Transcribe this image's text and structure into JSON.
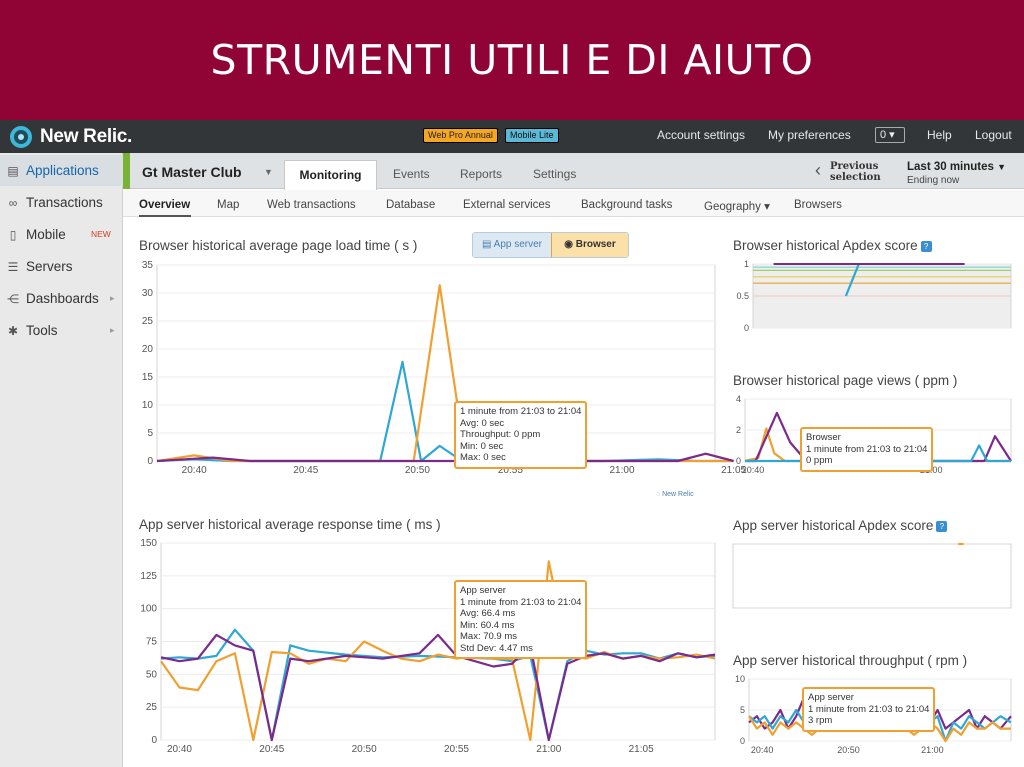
{
  "banner": {
    "title": "STRUMENTI UTILI E DI AIUTO"
  },
  "topbar": {
    "logo": "New Relic.",
    "badges": [
      "Web Pro Annual",
      "Mobile Lite"
    ],
    "links": [
      "Account settings",
      "My preferences",
      "Help",
      "Logout"
    ],
    "counter": "0 ▾"
  },
  "sidebar": {
    "items": [
      {
        "label": "Applications",
        "icon": "applications-icon",
        "active": true
      },
      {
        "label": "Transactions",
        "icon": "transactions-icon"
      },
      {
        "label": "Mobile",
        "icon": "mobile-icon",
        "badge": "NEW"
      },
      {
        "label": "Servers",
        "icon": "servers-icon"
      },
      {
        "label": "Dashboards",
        "icon": "dashboards-icon",
        "arrow": true
      },
      {
        "label": "Tools",
        "icon": "tools-icon",
        "arrow": true
      }
    ]
  },
  "appbar": {
    "app_name": "Gt Master Club",
    "tabs": [
      "Monitoring",
      "Events",
      "Reports",
      "Settings"
    ],
    "active_tab": "Monitoring",
    "previous_selection": [
      "Previous",
      "selection"
    ],
    "range": "Last 30 minutes",
    "range_sub": "Ending now"
  },
  "subnav": {
    "items": [
      "Overview",
      "Map",
      "Web transactions",
      "Database",
      "External services",
      "Background tasks",
      "Geography ▾",
      "Browsers"
    ],
    "active": "Overview"
  },
  "toggle": {
    "app_server": "App server",
    "browser": "Browser"
  },
  "watermark": "New Relic",
  "colors": {
    "banner": "#8f0335",
    "blue": "#2fa7d6",
    "orange": "#f0a030",
    "purple": "#7b2a8c"
  },
  "chart_data": [
    {
      "id": "browser-load",
      "type": "line",
      "title": "Browser historical average page load time ( s )",
      "ylim": [
        0,
        35
      ],
      "yticks": [
        0,
        5,
        10,
        15,
        20,
        25,
        30,
        35
      ],
      "xlim": [
        0,
        30
      ],
      "xticks": [
        {
          "x": 2,
          "label": "20:40"
        },
        {
          "x": 8,
          "label": "20:45"
        },
        {
          "x": 14,
          "label": "20:50"
        },
        {
          "x": 19,
          "label": "20:55"
        },
        {
          "x": 25,
          "label": "21:00"
        },
        {
          "x": 31,
          "label": "21:05"
        }
      ],
      "series": [
        {
          "color": "#2fa7d6",
          "x": [
            0,
            2,
            4,
            8,
            11,
            12,
            13.2,
            14.2,
            15.2,
            16.4,
            18,
            20,
            22,
            24,
            27,
            29,
            31
          ],
          "y": [
            0,
            0.3,
            0,
            0,
            0,
            0,
            17.7,
            0,
            2.7,
            0,
            0,
            0,
            0,
            0,
            0.3,
            0,
            0
          ]
        },
        {
          "color": "#f0a030",
          "x": [
            0,
            2,
            4,
            8,
            12,
            13.8,
            15.2,
            16.6,
            18,
            20,
            24,
            27,
            29,
            31
          ],
          "y": [
            0,
            1,
            0,
            0,
            0,
            0,
            31.4,
            0,
            0,
            0,
            0,
            0,
            0,
            0
          ]
        },
        {
          "color": "#7b2a8c",
          "x": [
            0,
            1.5,
            3,
            5,
            8,
            12,
            16,
            17.5,
            19,
            20.5,
            22,
            26,
            28,
            29.5,
            31
          ],
          "y": [
            0,
            0.3,
            0.6,
            0,
            0,
            0,
            0,
            1.3,
            1.4,
            0.3,
            0,
            0,
            0,
            1.3,
            0
          ]
        }
      ],
      "tooltip": [
        "1 minute from 21:03 to 21:04",
        "Avg: 0 sec",
        "Throughput: 0 ppm",
        "Min: 0 sec",
        "Max: 0 sec"
      ]
    },
    {
      "id": "app-response",
      "type": "line",
      "title": "App server historical average response time ( ms )",
      "ylim": [
        0,
        150
      ],
      "yticks": [
        0,
        25,
        50,
        75,
        100,
        125,
        150
      ],
      "xlim": [
        0,
        30
      ],
      "xticks": [
        {
          "x": 1,
          "label": "20:40"
        },
        {
          "x": 6,
          "label": "20:45"
        },
        {
          "x": 11,
          "label": "20:50"
        },
        {
          "x": 16,
          "label": "20:55"
        },
        {
          "x": 21,
          "label": "21:00"
        },
        {
          "x": 26,
          "label": "21:05"
        }
      ],
      "series": [
        {
          "color": "#2fa7d6",
          "x": [
            0,
            1,
            2,
            3,
            4,
            5,
            6,
            7,
            8,
            10,
            12,
            14,
            16,
            18,
            19,
            20,
            21,
            22,
            23,
            24,
            25,
            26,
            27,
            28,
            29,
            30
          ],
          "y": [
            62,
            63,
            62,
            64,
            84,
            68,
            0,
            72,
            68,
            65,
            63,
            64,
            63,
            62,
            60,
            64,
            0,
            60,
            68,
            65,
            66,
            66,
            62,
            66,
            63,
            64
          ]
        },
        {
          "color": "#f0a030",
          "x": [
            0,
            1,
            2,
            3,
            4,
            5,
            6,
            7,
            8,
            9,
            10,
            11,
            12,
            13,
            14,
            15,
            16,
            17,
            18,
            19,
            20,
            21,
            22,
            23,
            24,
            25,
            26,
            27,
            28,
            29,
            30
          ],
          "y": [
            60,
            40,
            38,
            60,
            66,
            0,
            67,
            66,
            58,
            62,
            60,
            75,
            68,
            62,
            60,
            65,
            62,
            64,
            62,
            62,
            0,
            136,
            66,
            62,
            67,
            62,
            64,
            62,
            63,
            65,
            62
          ]
        },
        {
          "color": "#7b2a8c",
          "x": [
            0,
            1,
            2,
            3,
            4,
            5,
            6,
            7,
            8,
            10,
            12,
            14,
            15,
            16,
            17,
            18,
            19,
            20,
            21,
            22,
            23,
            24,
            25,
            26,
            27,
            28,
            29,
            30
          ],
          "y": [
            63,
            60,
            62,
            80,
            72,
            68,
            0,
            62,
            60,
            64,
            62,
            66,
            80,
            64,
            60,
            56,
            58,
            72,
            0,
            58,
            64,
            66,
            62,
            64,
            60,
            66,
            63,
            65
          ]
        }
      ],
      "tooltip": [
        "App server",
        "1 minute from 21:03 to 21:04",
        "Avg: 66.4 ms",
        "Min: 60.4 ms",
        "Max: 70.9 ms",
        "Std Dev: 4.47 ms"
      ]
    },
    {
      "id": "browser-apdex",
      "type": "line",
      "title": "Browser historical Apdex score",
      "ylim": [
        0,
        1
      ],
      "yticks": [
        0,
        0.5,
        1
      ],
      "xlim": [
        0,
        10
      ],
      "bands": [
        {
          "y": 0.95,
          "color": "#7fd3d3"
        },
        {
          "y": 0.9,
          "color": "#9bd16a"
        },
        {
          "y": 0.8,
          "color": "#e6cf4a"
        },
        {
          "y": 0.7,
          "color": "#f0a030"
        },
        {
          "y": 0.5,
          "color": "#e06060"
        }
      ],
      "series": [
        {
          "color": "#2fa7d6",
          "x": [
            3.6,
            4.1
          ],
          "y": [
            0.5,
            1
          ]
        },
        {
          "color": "#7b2a8c",
          "x": [
            0.8,
            1.2,
            1.5,
            3.2,
            5.4,
            5.7,
            7.8,
            8.2
          ],
          "y": [
            1,
            1,
            1,
            1,
            1,
            1,
            1,
            1
          ]
        }
      ]
    },
    {
      "id": "browser-views",
      "type": "line",
      "title": "Browser historical page views ( ppm )",
      "ylim": [
        0,
        4
      ],
      "yticks": [
        0,
        2,
        4
      ],
      "xlim": [
        0,
        10
      ],
      "xticks": [
        {
          "x": 0.3,
          "label": "20:40"
        },
        {
          "x": 7,
          "label": "21:00"
        }
      ],
      "series": [
        {
          "color": "#f0a030",
          "x": [
            0,
            0.5,
            0.8,
            1.1,
            1.5,
            4,
            7,
            8.5,
            9.2,
            10
          ],
          "y": [
            0,
            0.2,
            2.1,
            0.5,
            0,
            0,
            0,
            0,
            0,
            0
          ]
        },
        {
          "color": "#7b2a8c",
          "x": [
            0,
            0.4,
            1.2,
            1.7,
            2.3,
            4,
            7,
            8.6,
            9,
            9.4,
            10
          ],
          "y": [
            0,
            0,
            3.1,
            1.2,
            0,
            0,
            0,
            0,
            0,
            1.6,
            0
          ]
        },
        {
          "color": "#2fa7d6",
          "x": [
            0,
            4,
            7,
            8.5,
            8.8,
            9.1,
            9.6,
            10
          ],
          "y": [
            0,
            0,
            0,
            0,
            1,
            0,
            0,
            0
          ]
        }
      ],
      "tooltip": [
        "Browser",
        "1 minute from 21:03 to 21:04",
        "0 ppm"
      ]
    },
    {
      "id": "app-apdex",
      "type": "line",
      "title": "App server historical Apdex score",
      "ylim": [
        0,
        1
      ],
      "xlim": [
        0,
        10
      ],
      "series": [
        {
          "color": "#f0a030",
          "x": [
            8.1,
            8.3
          ],
          "y": [
            1,
            1
          ]
        }
      ]
    },
    {
      "id": "app-throughput",
      "type": "line",
      "title": "App server historical throughput ( rpm )",
      "ylim": [
        0,
        10
      ],
      "yticks": [
        0,
        5,
        10
      ],
      "xlim": [
        0,
        10
      ],
      "xticks": [
        {
          "x": 0.5,
          "label": "20:40"
        },
        {
          "x": 3.8,
          "label": "20:50"
        },
        {
          "x": 7,
          "label": "21:00"
        }
      ],
      "series": [
        {
          "color": "#7b2a8c",
          "x": [
            0,
            0.3,
            0.6,
            0.9,
            1.2,
            1.5,
            1.8,
            2.1,
            2.4,
            2.7,
            3,
            3.3,
            3.6,
            3.9,
            4.2,
            4.5,
            4.8,
            5.1,
            5.4,
            5.7,
            6,
            6.3,
            6.6,
            6.9,
            7.2,
            7.5,
            7.8,
            8.1,
            8.4,
            8.7,
            9,
            9.3,
            9.6,
            10
          ],
          "y": [
            3,
            4,
            2,
            3,
            5,
            2,
            4,
            7,
            3,
            5,
            2,
            4,
            3,
            5,
            2,
            4,
            3,
            5,
            4,
            3,
            6,
            2,
            4,
            3,
            5,
            2,
            3,
            4,
            5,
            2,
            4,
            3,
            2,
            4
          ]
        },
        {
          "color": "#2fa7d6",
          "x": [
            0,
            0.3,
            0.6,
            0.9,
            1.2,
            1.5,
            1.8,
            2.1,
            2.4,
            2.7,
            3,
            3.3,
            3.6,
            3.9,
            4.2,
            4.5,
            4.8,
            5.1,
            5.4,
            5.7,
            6,
            6.3,
            6.6,
            6.9,
            7.2,
            7.5,
            7.8,
            8.1,
            8.4,
            8.7,
            9,
            9.3,
            9.6,
            10
          ],
          "y": [
            4,
            3,
            4,
            2,
            4,
            3,
            5,
            3,
            2,
            4,
            3,
            3,
            4,
            2,
            3,
            4,
            3,
            2,
            3,
            4,
            3,
            4,
            2,
            3,
            4,
            0,
            3,
            2,
            4,
            3,
            2,
            3,
            4,
            3
          ]
        },
        {
          "color": "#f0a030",
          "x": [
            0,
            0.3,
            0.6,
            0.9,
            1.2,
            1.5,
            1.8,
            2.1,
            2.4,
            2.7,
            3,
            3.3,
            3.6,
            3.9,
            4.2,
            4.5,
            4.8,
            5.1,
            5.4,
            5.7,
            6,
            6.3,
            6.6,
            6.9,
            7.2,
            7.5,
            7.8,
            8.1,
            8.4,
            8.7,
            9,
            9.3,
            9.6,
            10
          ],
          "y": [
            4,
            2,
            3,
            1,
            3,
            2,
            3,
            2,
            1,
            2,
            3,
            2,
            2,
            3,
            2,
            2,
            3,
            2,
            2,
            3,
            2,
            1,
            2,
            3,
            2,
            0,
            2,
            1,
            3,
            2,
            2,
            3,
            2,
            2
          ]
        }
      ],
      "tooltip": [
        "App server",
        "1 minute from 21:03 to 21:04",
        "3 rpm"
      ]
    }
  ]
}
